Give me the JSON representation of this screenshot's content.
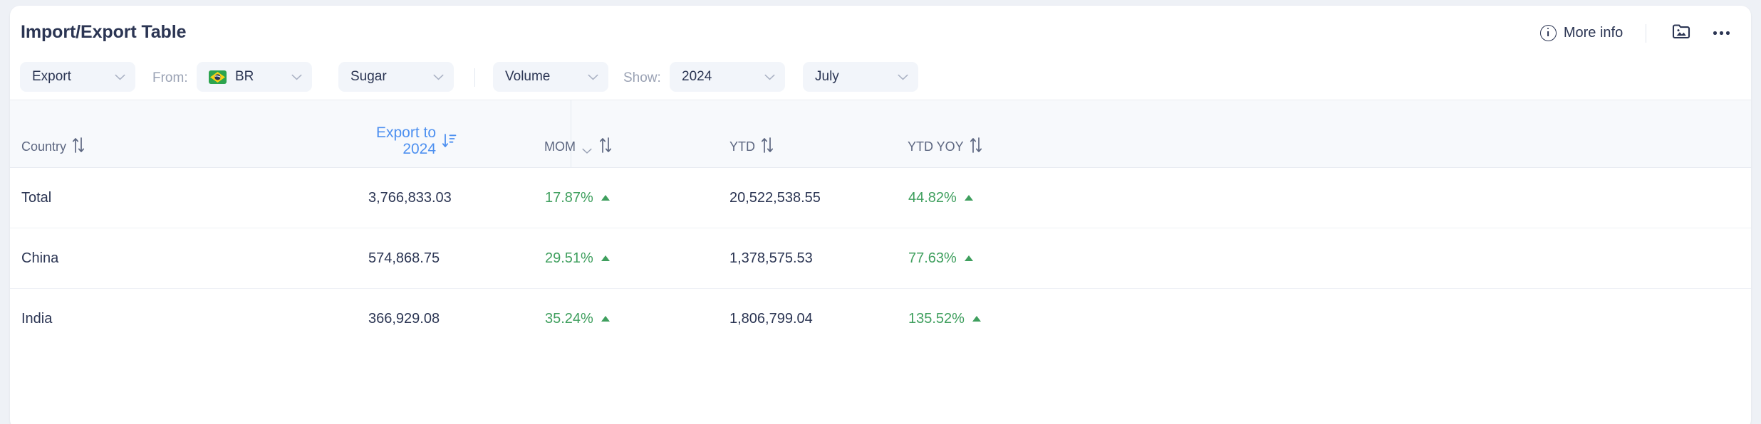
{
  "header": {
    "title": "Import/Export Table",
    "more_info_label": "More info",
    "info_icon": "info-circle-icon",
    "image_folder_icon": "image-folder-icon",
    "overflow_icon": "ellipsis-icon"
  },
  "filters": {
    "direction": {
      "value": "Export",
      "icon": "chevron-down-icon"
    },
    "from_label": "From:",
    "country": {
      "value": "BR",
      "flag": "brazil-flag-icon",
      "icon": "chevron-down-icon"
    },
    "commodity": {
      "value": "Sugar",
      "icon": "chevron-down-icon"
    },
    "metric": {
      "value": "Volume",
      "icon": "chevron-down-icon"
    },
    "show_label": "Show:",
    "year": {
      "value": "2024",
      "icon": "chevron-down-icon"
    },
    "month": {
      "value": "July",
      "icon": "chevron-down-icon"
    }
  },
  "table": {
    "columns": [
      {
        "label": "Country",
        "sort_icon": "sort-updown-icon",
        "active": false
      },
      {
        "label": "Export to",
        "sublabel": "2024",
        "sort_icon": "sort-descending-icon",
        "active": true
      },
      {
        "label": "MOM",
        "dropdown_icon": "chevron-down-icon",
        "sort_icon": "sort-updown-icon",
        "active": false
      },
      {
        "label": "YTD",
        "sort_icon": "sort-updown-icon",
        "active": false
      },
      {
        "label": "YTD YOY",
        "sort_icon": "sort-updown-icon",
        "active": false
      }
    ],
    "rows": [
      {
        "country": "Total",
        "export_to": "3,766,833.03",
        "mom": "17.87%",
        "mom_dir": "up",
        "ytd": "20,522,538.55",
        "ytd_yoy": "44.82%",
        "ytd_yoy_dir": "up"
      },
      {
        "country": "China",
        "export_to": "574,868.75",
        "mom": "29.51%",
        "mom_dir": "up",
        "ytd": "1,378,575.53",
        "ytd_yoy": "77.63%",
        "ytd_yoy_dir": "up"
      },
      {
        "country": "India",
        "export_to": "366,929.08",
        "mom": "35.24%",
        "mom_dir": "up",
        "ytd": "1,806,799.04",
        "ytd_yoy": "135.52%",
        "ytd_yoy_dir": "up"
      }
    ]
  },
  "colors": {
    "accent_blue": "#4d90f0",
    "positive_green": "#3f9f5e",
    "text_dark": "#2b3553",
    "muted": "#9aa2b4",
    "control_bg": "#f2f5fa",
    "header_bg": "#f7f9fc"
  }
}
